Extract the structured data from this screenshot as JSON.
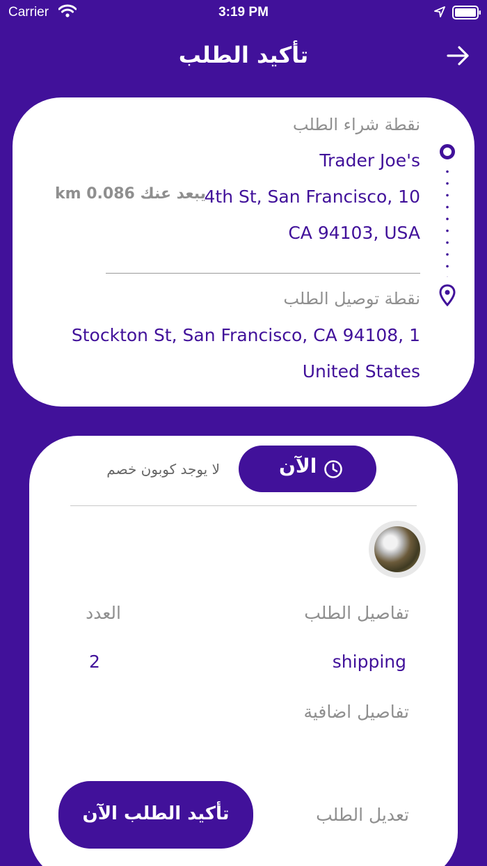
{
  "status_bar": {
    "carrier": "Carrier",
    "time": "3:19 PM"
  },
  "header": {
    "title": "تأكيد الطلب",
    "back_icon": "arrow-right-icon"
  },
  "pickup": {
    "label": "نقطة شراء الطلب",
    "store": "Trader Joe's",
    "address_line1": "4th St, San Francisco, 10",
    "address_line2": "CA 94103, USA",
    "distance": "يبعد عنك 0.086 km"
  },
  "delivery": {
    "label": "نقطة توصيل الطلب",
    "address_line1": "Stockton St, San Francisco, CA  94108, 1",
    "address_line2": "United States"
  },
  "order": {
    "time_button": "الآن",
    "coupon_text": "لا يوجد كوبون خصم",
    "details_label": "تفاصيل الطلب",
    "quantity_label": "العدد",
    "item_name": "shipping",
    "item_quantity": "2",
    "extra_details_label": "تفاصيل اضافية",
    "edit_label": "تعديل الطلب",
    "confirm_button": "تأكيد الطلب الآن"
  },
  "colors": {
    "primary": "#41119a",
    "background": "#41119a",
    "card": "#ffffff",
    "label_gray": "#8f8f8f"
  }
}
